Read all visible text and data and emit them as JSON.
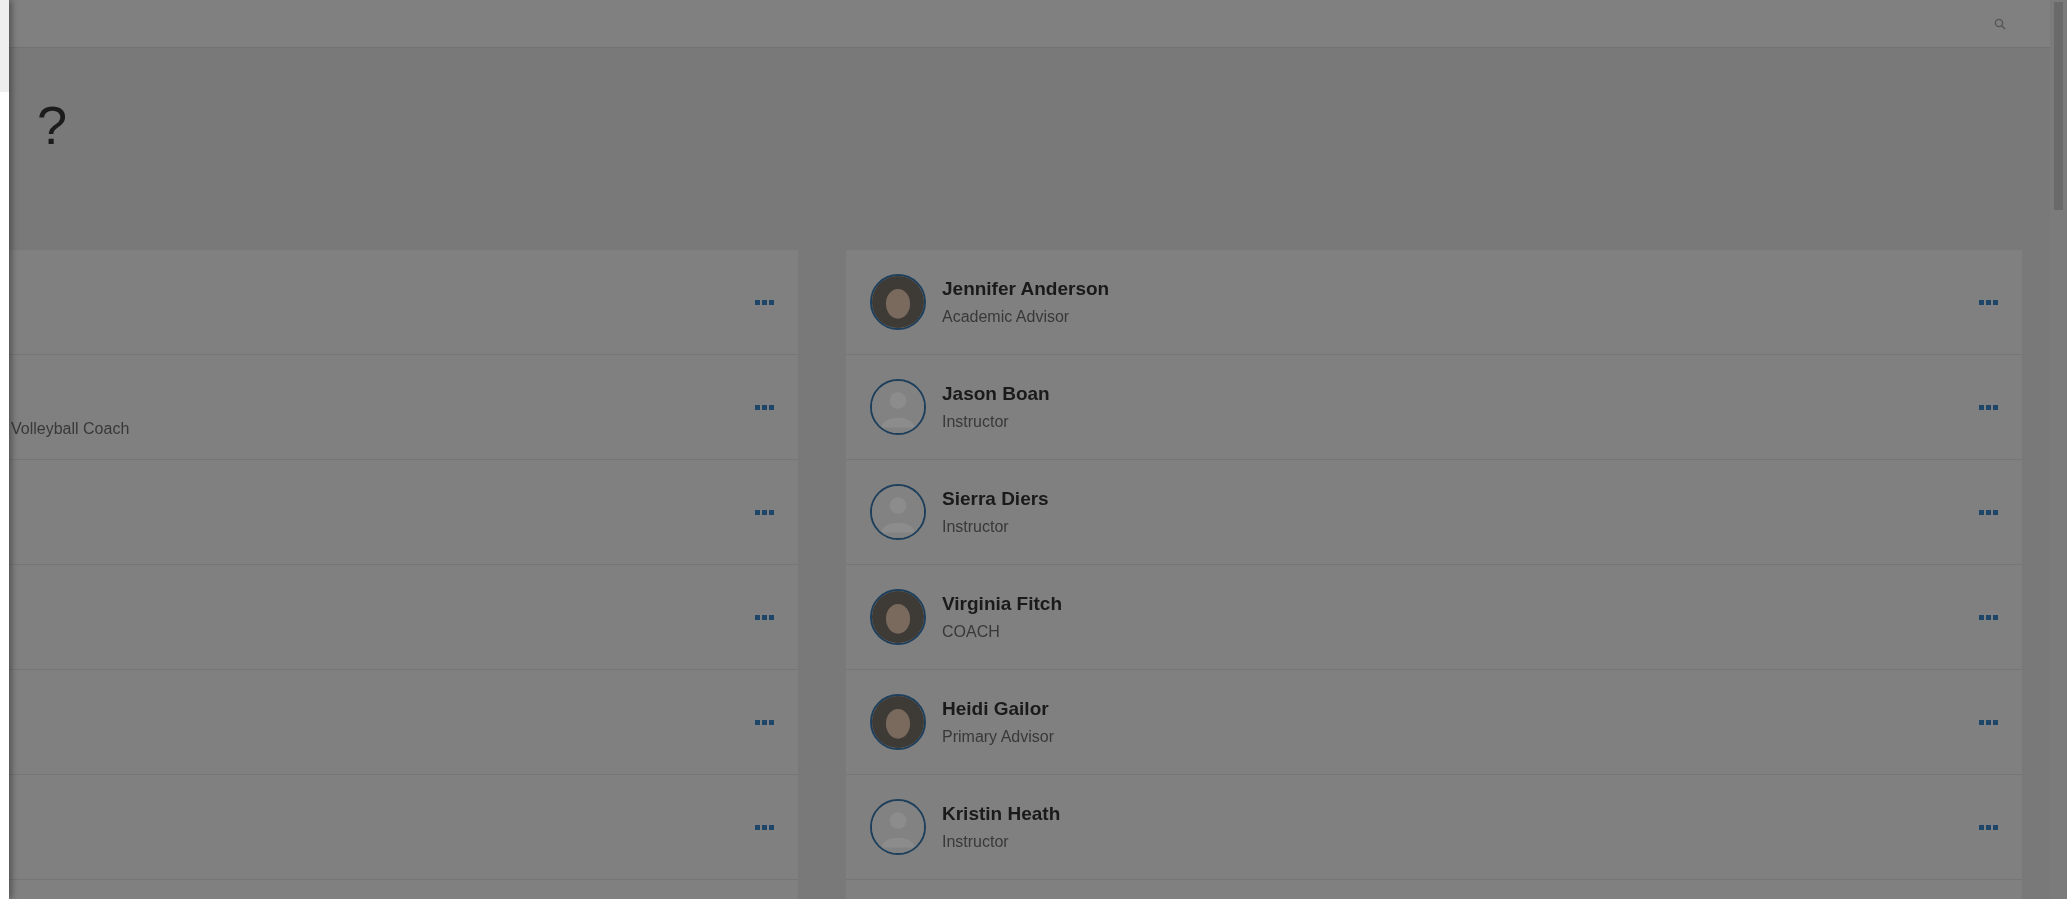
{
  "heading": "?",
  "left_list": [
    {
      "has_menu": true
    },
    {
      "subtitle": "Volleyball Coach",
      "has_menu": true
    },
    {
      "has_menu": true
    },
    {
      "has_menu": true
    },
    {
      "has_menu": true
    },
    {
      "has_menu": true
    }
  ],
  "right_list": [
    {
      "name": "Jennifer Anderson",
      "role": "Academic Advisor",
      "has_photo": true,
      "has_menu": true
    },
    {
      "name": "Jason Boan",
      "role": "Instructor",
      "has_photo": false,
      "has_menu": true
    },
    {
      "name": "Sierra Diers",
      "role": "Instructor",
      "has_photo": false,
      "has_menu": true
    },
    {
      "name": "Virginia Fitch",
      "role": "COACH",
      "has_photo": true,
      "has_menu": true
    },
    {
      "name": "Heidi Gailor",
      "role": "Primary Advisor",
      "has_photo": true,
      "has_menu": true
    },
    {
      "name": "Kristin Heath",
      "role": "Instructor",
      "has_photo": false,
      "has_menu": true
    }
  ]
}
